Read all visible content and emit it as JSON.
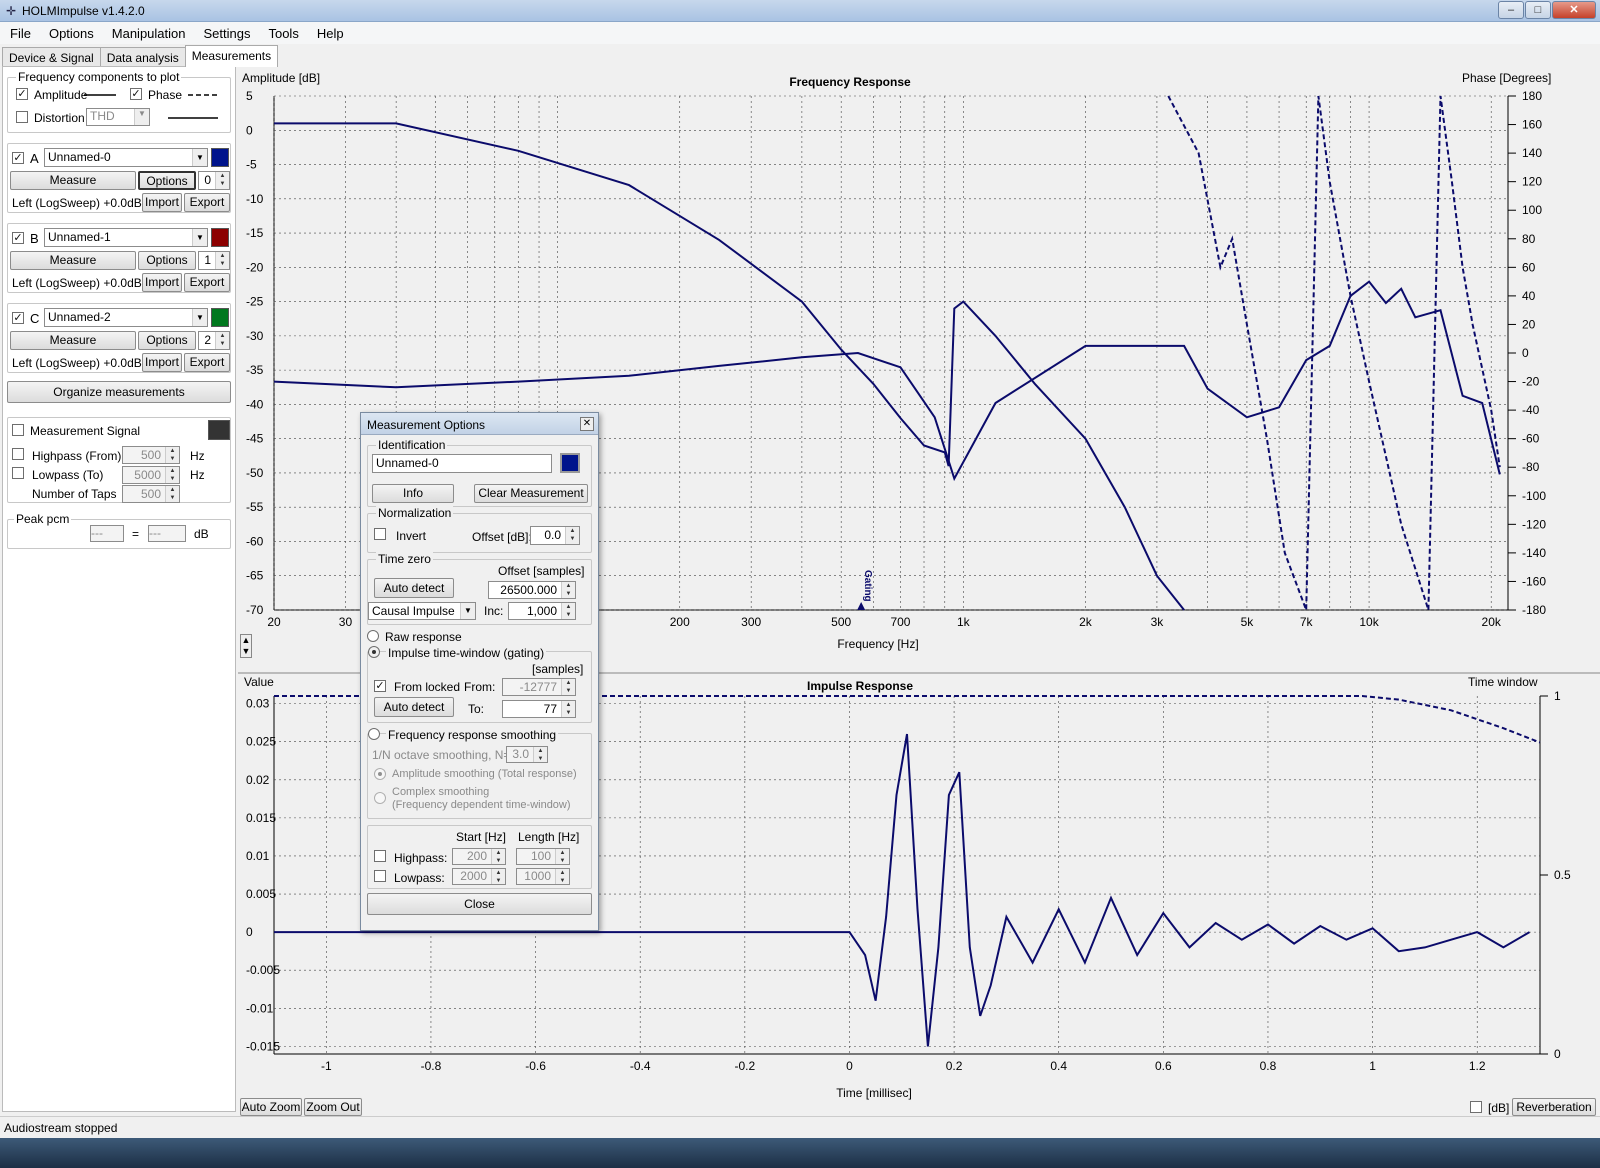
{
  "window": {
    "title": "HOLMImpulse  v1.4.2.0",
    "app_icon": "holm-logo-icon",
    "min": "–",
    "max": "□",
    "close": "✕"
  },
  "menu": [
    "File",
    "Options",
    "Manipulation",
    "Settings",
    "Tools",
    "Help"
  ],
  "tabs": [
    {
      "label": "Device & Signal"
    },
    {
      "label": "Data analysis"
    },
    {
      "label": "Measurements",
      "active": true
    }
  ],
  "freq_components": {
    "title": "Frequency components to plot",
    "amplitude": "Amplitude",
    "amplitude_checked": true,
    "phase": "Phase",
    "phase_checked": true,
    "distortion": "Distortion",
    "distortion_checked": false,
    "distortion_select": "THD"
  },
  "measurements": [
    {
      "letter": "A",
      "checked": true,
      "name": "Unnamed-0",
      "color": "#00148c",
      "measure": "Measure",
      "options": "Options",
      "index": "0",
      "source": "Left (LogSweep) +0.0dB",
      "import": "Import",
      "export": "Export"
    },
    {
      "letter": "B",
      "checked": true,
      "name": "Unnamed-1",
      "color": "#8c0000",
      "measure": "Measure",
      "options": "Options",
      "index": "1",
      "source": "Left (LogSweep) +0.0dB",
      "import": "Import",
      "export": "Export"
    },
    {
      "letter": "C",
      "checked": true,
      "name": "Unnamed-2",
      "color": "#00781e",
      "measure": "Measure",
      "options": "Options",
      "index": "2",
      "source": "Left (LogSweep) +0.0dB",
      "import": "Import",
      "export": "Export"
    }
  ],
  "organize": "Organize measurements",
  "signal": {
    "label": "Measurement Signal",
    "color": "#333333",
    "highpass": "Highpass (From)",
    "highpass_val": "500",
    "lowpass": "Lowpass (To)",
    "lowpass_val": "5000",
    "hz": "Hz",
    "taps": "Number of Taps",
    "taps_val": "500"
  },
  "peak": {
    "label": "Peak pcm",
    "val1": "---",
    "eq": "=",
    "val2": "---",
    "unit": "dB"
  },
  "freq_plot": {
    "title": "Frequency Response",
    "left_label": "Amplitude [dB]",
    "right_label": "Phase [Degrees]",
    "xlabel": "Frequency [Hz]",
    "gating_label": "Gating"
  },
  "imp_plot": {
    "title": "Impulse Response",
    "left_label": "Value",
    "right_label": "Time window",
    "xlabel": "Time [millisec]"
  },
  "buttons": {
    "auto_zoom": "Auto Zoom",
    "zoom_out": "Zoom Out",
    "db": "[dB]",
    "reverberation": "Reverberation"
  },
  "status": "Audiostream stopped",
  "dialog": {
    "title": "Measurement Options",
    "identification": "Identification",
    "name": "Unnamed-0",
    "color": "#00148c",
    "info": "Info",
    "clear": "Clear Measurement",
    "normalization": "Normalization",
    "invert": "Invert",
    "offset_db_label": "Offset [dB]:",
    "offset_db": "0.0",
    "time_zero": "Time zero",
    "offset_samples_label": "Offset [samples]",
    "auto_detect": "Auto detect",
    "offset_samples": "26500.000",
    "causal": "Causal Impulse",
    "inc_label": "Inc:",
    "inc": "1,000",
    "raw": "Raw response",
    "gating": "Impulse time-window (gating)",
    "samples": "[samples]",
    "from_locked": "From locked",
    "from_label": "From:",
    "from": "-12777",
    "auto_detect2": "Auto detect",
    "to_label": "To:",
    "to": "77",
    "smoothing": "Frequency response smoothing",
    "octave": "1/N octave smoothing, N=",
    "octave_val": "3.0",
    "amp_smooth": "Amplitude smoothing (Total response)",
    "complex1": "Complex smoothing",
    "complex2": "(Frequency dependent time-window)",
    "start_hz": "Start [Hz]",
    "length_hz": "Length [Hz]",
    "highpass": "Highpass:",
    "hp_start": "200",
    "hp_len": "100",
    "lowpass": "Lowpass:",
    "lp_start": "2000",
    "lp_len": "1000",
    "close": "Close"
  },
  "chart_data": [
    {
      "type": "line",
      "title": "Frequency Response",
      "xlabel": "Frequency [Hz]",
      "ylabel": "Amplitude [dB]",
      "y2label": "Phase [Degrees]",
      "xscale": "log",
      "xlim": [
        20,
        22000
      ],
      "ylim": [
        -70,
        5
      ],
      "y2lim": [
        -180,
        180
      ],
      "xticks": [
        20,
        30,
        200,
        300,
        500,
        700,
        1000,
        2000,
        3000,
        5000,
        7000,
        10000,
        20000
      ],
      "xticklabels": [
        "20",
        "30",
        "200",
        "300",
        "500",
        "700",
        "1k",
        "2k",
        "3k",
        "5k",
        "7k",
        "10k",
        "20k"
      ],
      "yticks": [
        5,
        0,
        -5,
        -10,
        -15,
        -20,
        -25,
        -30,
        -35,
        -40,
        -45,
        -50,
        -55,
        -60,
        -65,
        -70
      ],
      "y2ticks": [
        180,
        160,
        140,
        120,
        100,
        80,
        60,
        40,
        20,
        0,
        -20,
        -40,
        -60,
        -80,
        -100,
        -120,
        -140,
        -160,
        -180
      ],
      "grid": true,
      "gating_marker_x": 560,
      "series": [
        {
          "axis": "left",
          "color": "#0b0b6b",
          "style": "solid",
          "x": [
            20,
            40,
            80,
            150,
            250,
            400,
            500,
            600,
            700,
            800,
            900,
            920,
            950,
            1000,
            1200,
            1500,
            2000,
            2500,
            3000,
            3500
          ],
          "y": [
            1,
            1,
            -3,
            -8,
            -16,
            -25,
            -32,
            -37,
            -42,
            -46,
            -47,
            -49,
            -26,
            -25,
            -30,
            -37,
            -45,
            -55,
            -65,
            -70
          ]
        },
        {
          "axis": "right",
          "color": "#0b0b6b",
          "style": "solid",
          "x": [
            20,
            40,
            80,
            150,
            250,
            400,
            550,
            700,
            850,
            950,
            1200,
            2000,
            3500,
            4000,
            5000,
            6000,
            7000,
            8000,
            9000,
            10000,
            11000,
            12000,
            13000,
            15000,
            17000,
            19000,
            21000
          ],
          "y": [
            -20,
            -24,
            -20,
            -16,
            -9,
            -3,
            0,
            -10,
            -45,
            -88,
            -35,
            5,
            5,
            -25,
            -45,
            -38,
            -5,
            5,
            40,
            50,
            35,
            45,
            25,
            30,
            -30,
            -35,
            -85
          ]
        },
        {
          "axis": "right",
          "color": "#0b0b6b",
          "style": "dashed",
          "x": [
            3200,
            3800,
            4300,
            4600,
            5000,
            5600,
            6200,
            7000,
            7500,
            8000,
            9000,
            10000,
            12000,
            14000,
            15000,
            16000,
            17000,
            18000,
            20000,
            21000
          ],
          "y": [
            180,
            140,
            60,
            80,
            20,
            -60,
            -140,
            -180,
            180,
            120,
            40,
            -20,
            -120,
            -180,
            180,
            120,
            60,
            20,
            -40,
            -80
          ]
        }
      ]
    },
    {
      "type": "line",
      "title": "Impulse Response",
      "xlabel": "Time [millisec]",
      "ylabel": "Value",
      "y2label": "Time window",
      "xlim": [
        -1.1,
        1.32
      ],
      "ylim": [
        -0.016,
        0.031
      ],
      "y2lim": [
        0,
        1
      ],
      "xticks": [
        -1,
        -0.8,
        -0.6,
        -0.4,
        -0.2,
        0,
        0.2,
        0.4,
        0.6,
        0.8,
        1,
        1.2
      ],
      "yticks": [
        0.03,
        0.025,
        0.02,
        0.015,
        0.01,
        0.005,
        0,
        -0.005,
        -0.01,
        -0.015
      ],
      "y2ticks": [
        1,
        0.5,
        0
      ],
      "grid": true,
      "series": [
        {
          "axis": "left",
          "color": "#0b0b6b",
          "style": "solid",
          "x": [
            -1.1,
            0,
            0.03,
            0.05,
            0.07,
            0.09,
            0.11,
            0.13,
            0.15,
            0.17,
            0.19,
            0.21,
            0.23,
            0.25,
            0.27,
            0.3,
            0.35,
            0.4,
            0.45,
            0.5,
            0.55,
            0.6,
            0.65,
            0.7,
            0.75,
            0.8,
            0.85,
            0.9,
            0.95,
            1.0,
            1.05,
            1.1,
            1.15,
            1.2,
            1.25,
            1.3
          ],
          "y": [
            0,
            0,
            -0.003,
            -0.009,
            0.002,
            0.018,
            0.026,
            0.003,
            -0.015,
            -0.002,
            0.018,
            0.021,
            -0.002,
            -0.011,
            -0.007,
            0.002,
            -0.004,
            0.003,
            -0.004,
            0.0045,
            -0.003,
            0.0025,
            -0.002,
            0.0012,
            -0.001,
            0.001,
            -0.0015,
            0.0008,
            -0.001,
            0.0005,
            -0.0025,
            -0.002,
            -0.001,
            0.0,
            -0.002,
            0.0
          ]
        },
        {
          "axis": "right",
          "color": "#0b0b6b",
          "style": "dashed",
          "x": [
            -1.1,
            0.98,
            1.05,
            1.15,
            1.25,
            1.32
          ],
          "y": [
            1,
            1,
            0.99,
            0.96,
            0.91,
            0.87
          ]
        }
      ]
    }
  ]
}
